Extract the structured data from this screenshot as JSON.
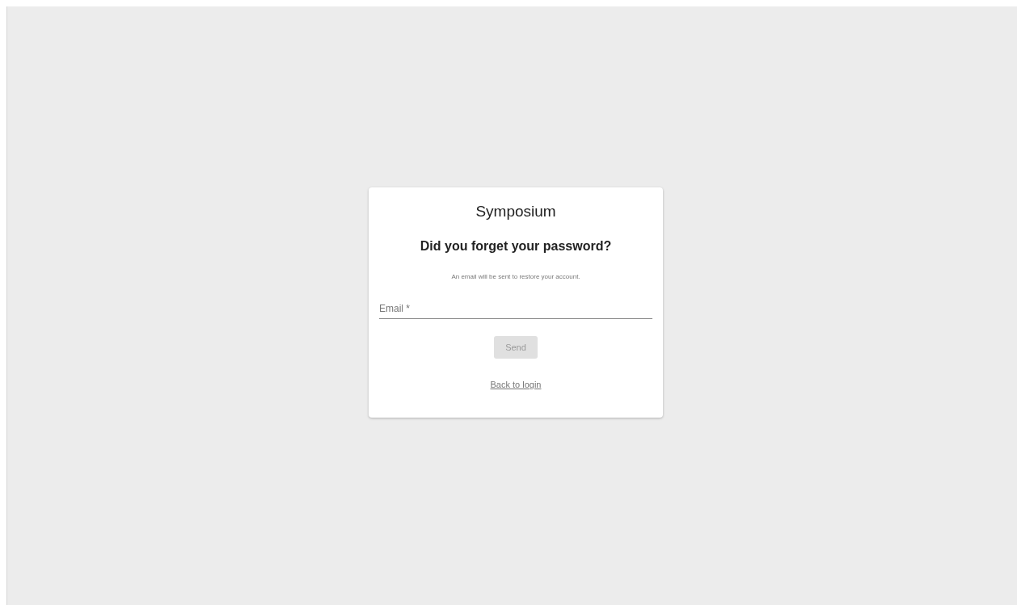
{
  "app_title": "Symposium",
  "heading": "Did you forget your password?",
  "description": "An email will be sent to restore your account.",
  "email_field": {
    "placeholder": "Email *"
  },
  "send_button": {
    "label": "Send",
    "disabled": true
  },
  "back_link": "Back to login"
}
